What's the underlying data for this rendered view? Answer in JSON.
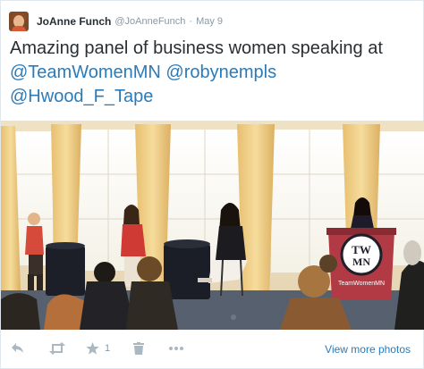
{
  "tweet": {
    "author_name": "JoAnne Funch",
    "author_handle": "@JoAnneFunch",
    "separator": "·",
    "time": "May 9",
    "text_before": "Amazing panel of business women speaking at ",
    "mentions": [
      "@TeamWomenMN",
      "@robynempls",
      "@Hwood_F_Tape"
    ]
  },
  "photo": {
    "podium_logo_line1": "TW",
    "podium_logo_line2": "MN",
    "podium_url": "TeamWomenMN"
  },
  "actions": {
    "reply_icon": "reply-icon",
    "retweet_icon": "retweet-icon",
    "favorite_icon": "star-icon",
    "favorite_count": "1",
    "delete_icon": "trash-icon",
    "more_icon": "more-dots-icon",
    "view_more_label": "View more photos"
  },
  "colors": {
    "link": "#2b7bb9",
    "muted": "#8899a6",
    "icon": "#aab8c2",
    "text": "#292f33"
  }
}
